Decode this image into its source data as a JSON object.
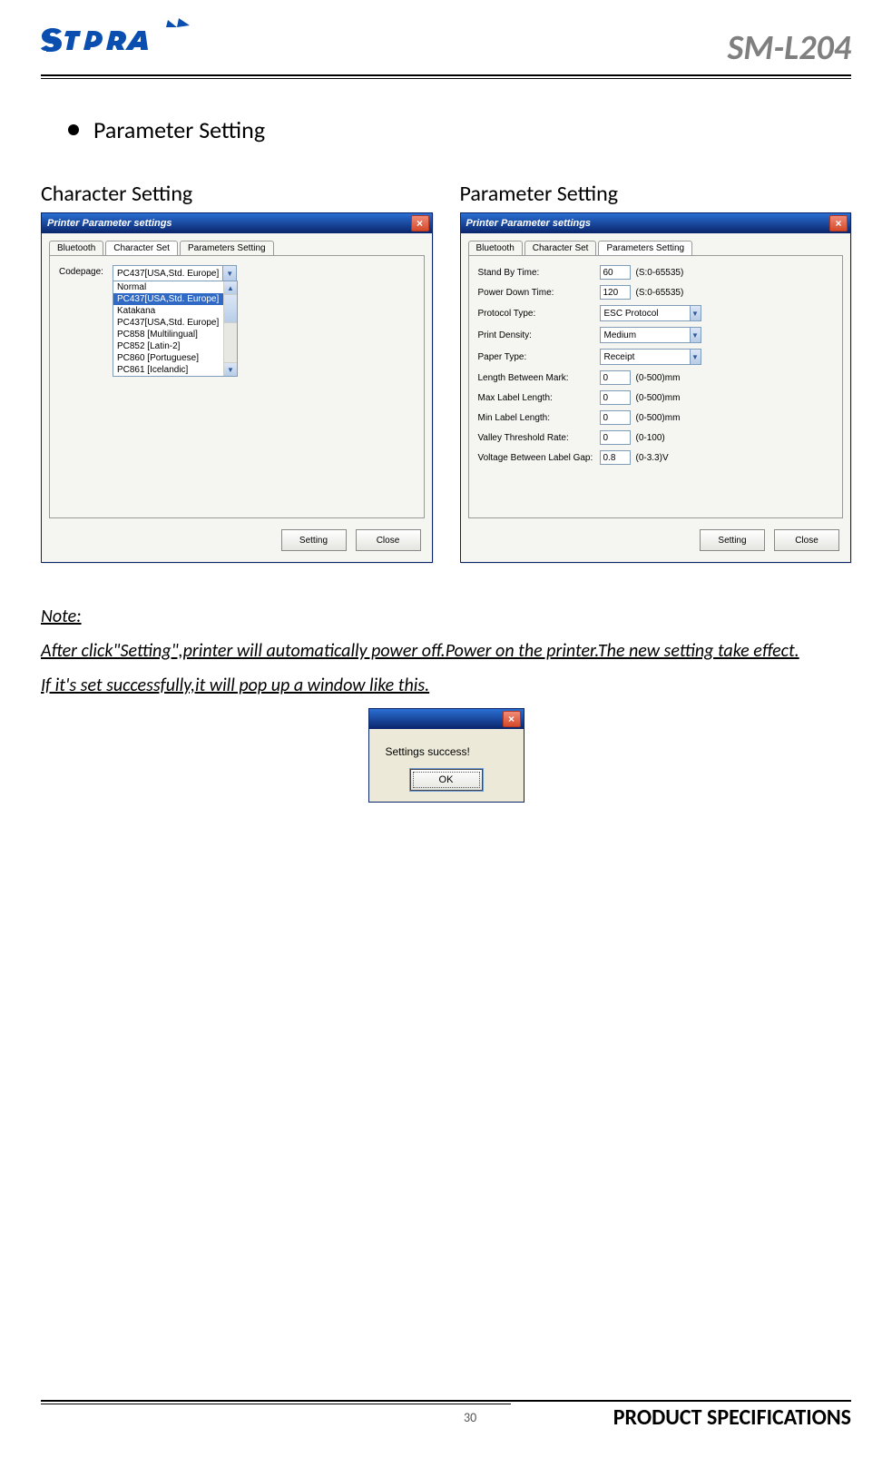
{
  "header": {
    "model": "SM-L204"
  },
  "section": {
    "bullet_title": "Parameter Setting"
  },
  "columns": {
    "left_title": "Character Setting",
    "right_title": "Parameter Setting"
  },
  "win_common": {
    "title": "Printer Parameter settings",
    "tabs": {
      "bluetooth": "Bluetooth",
      "charset": "Character Set",
      "params": "Parameters Setting"
    },
    "buttons": {
      "setting": "Setting",
      "close": "Close"
    },
    "close_x": "×"
  },
  "char_panel": {
    "codepage_label": "Codepage:",
    "combo_value": "PC437[USA,Std. Europe]",
    "list": {
      "0": "Normal",
      "1": "PC437[USA,Std. Europe]",
      "2": "Katakana",
      "3": "PC437[USA,Std. Europe]",
      "4": "PC858 [Multilingual]",
      "5": "PC852 [Latin-2]",
      "6": "PC860 [Portuguese]",
      "7": "PC861 [Icelandic]"
    },
    "arrow_up": "▲",
    "arrow_down": "▼"
  },
  "param_panel": {
    "rows": {
      "0": {
        "label": "Stand By Time:",
        "value": "60",
        "range": "(S:0-65535)"
      },
      "1": {
        "label": "Power Down Time:",
        "value": "120",
        "range": "(S:0-65535)"
      },
      "2": {
        "label": "Protocol Type:",
        "value": "ESC Protocol",
        "type": "combo"
      },
      "3": {
        "label": "Print Density:",
        "value": "Medium",
        "type": "combo"
      },
      "4": {
        "label": "Paper Type:",
        "value": "Receipt",
        "type": "combo"
      },
      "5": {
        "label": "Length Between Mark:",
        "value": "0",
        "range": "(0-500)mm"
      },
      "6": {
        "label": "Max Label Length:",
        "value": "0",
        "range": "(0-500)mm"
      },
      "7": {
        "label": "Min Label Length:",
        "value": "0",
        "range": "(0-500)mm"
      },
      "8": {
        "label": "Valley Threshold Rate:",
        "value": "0",
        "range": "(0-100)"
      },
      "9": {
        "label": "Voltage Between Label Gap:",
        "value": "0.8",
        "range": "(0-3.3)V"
      }
    },
    "arrow_down": "▼"
  },
  "note": {
    "heading": "Note:",
    "line1": "After click\"Setting\",printer will automatically power off.Power on the printer.The new setting take effect.",
    "line2": "If it's set successfully,it will pop up a window like this."
  },
  "popup": {
    "msg": "Settings success!",
    "ok": "OK",
    "close_x": "×"
  },
  "footer": {
    "page": "30",
    "spec": "PRODUCT SPECIFICATIONS"
  }
}
